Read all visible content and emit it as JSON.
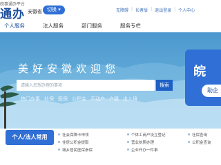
{
  "header": {
    "logo_sub": "皖事通办平台",
    "logo_main": "通办",
    "province": "安徽省",
    "switch_label": "切换 ▾",
    "links": [
      "无障碍",
      "长者版",
      "退出登录",
      "个人中心"
    ]
  },
  "nav": {
    "items": [
      "个人服务",
      "法人服务",
      "部门服务",
      "服务专栏"
    ]
  },
  "hero": {
    "title": "美好安徽欢迎您",
    "search_placeholder": "请输入您想办理的事项",
    "search_button": "搜索",
    "hot_links": [
      "热门办事",
      "社保",
      "医保",
      "公积金",
      "不动产",
      "户籍",
      "出入境"
    ],
    "side_card": {
      "title": "皖",
      "pill": "助企"
    }
  },
  "bottom": {
    "tab_label": "个人/法人常用",
    "list_left": [
      "社会保障卡申领",
      "住房公积金提取",
      "城乡居民医保参保"
    ],
    "list_mid": [
      "个体工商户设立登记",
      "营业执照办理",
      "企业开办一件事"
    ],
    "list_right": [
      "社保查询",
      "公积金查询"
    ]
  },
  "colors": {
    "brand": "#1d4f9c",
    "accent": "#2f6fd6",
    "hero_top": "#4c97cf"
  }
}
